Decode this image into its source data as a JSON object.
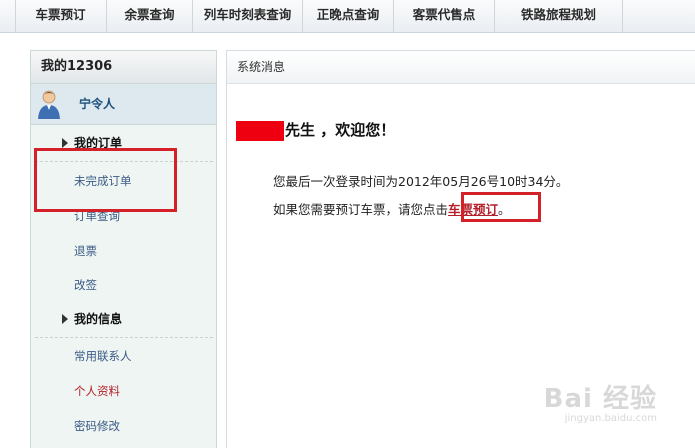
{
  "topnav": {
    "items": [
      "车票预订",
      "余票查询",
      "列车时刻表查询",
      "正晚点查询",
      "客票代售点",
      "铁路旅程规划"
    ]
  },
  "sidebar": {
    "title": "我的12306",
    "username": "宁令人",
    "sections": [
      {
        "label": "我的订单",
        "links": [
          "未完成订单",
          "订单查询",
          "退票",
          "改签"
        ]
      },
      {
        "label": "我的信息",
        "links": [
          "常用联系人",
          "个人资料",
          "密码修改"
        ]
      }
    ],
    "highlighted_link": "未完成订单",
    "active_link": "个人资料"
  },
  "main": {
    "title": "系统消息",
    "welcome_text": "先生 ，欢迎您！",
    "last_login": "您最后一次登录时间为2012年05月26号10时34分。",
    "prompt_prefix": "如果您需要预订车票，请您点击",
    "ticket_link": "车票预订",
    "prompt_suffix": "。"
  },
  "watermark": {
    "main": "Bai 经验",
    "sub": "jingyan.baidu.com"
  },
  "colors": {
    "highlight_box": "#d42029",
    "link_blue": "#3a5a86",
    "link_red": "#b3202a",
    "redaction": "#ee0010"
  }
}
